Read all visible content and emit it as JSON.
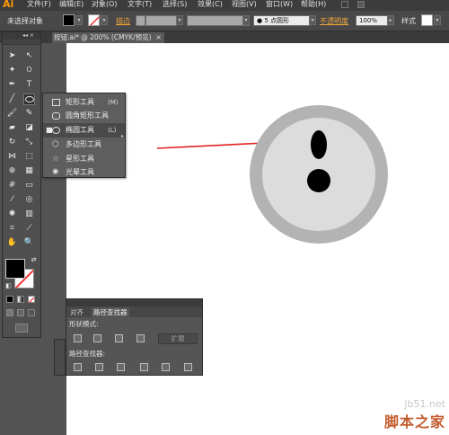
{
  "app": {
    "logo": "Ai"
  },
  "menubar": {
    "items": [
      "文件(F)",
      "编辑(E)",
      "对象(O)",
      "文字(T)",
      "选择(S)",
      "效果(C)",
      "视图(V)",
      "窗口(W)",
      "帮助(H)"
    ]
  },
  "controlbar": {
    "selection_label": "未选择对象",
    "fill_color": "#000000",
    "stroke_label": "描边",
    "brush_label": "5 点圆形",
    "opacity_label": "不透明度",
    "opacity_value": "100%",
    "style_label": "样式"
  },
  "document": {
    "tab_title": "按钮.ai* @ 200% (CMYK/预览)",
    "close_glyph": "×"
  },
  "toolbox": {
    "header": "◂◂ ×"
  },
  "flyout": {
    "items": [
      {
        "label": "矩形工具",
        "shortcut": "(M)",
        "icon": "rectangle-icon",
        "selected": false
      },
      {
        "label": "圆角矩形工具",
        "shortcut": "",
        "icon": "rounded-rectangle-icon",
        "selected": false
      },
      {
        "label": "椭圆工具",
        "shortcut": "(L)",
        "icon": "ellipse-icon",
        "selected": true
      },
      {
        "label": "多边形工具",
        "shortcut": "",
        "icon": "polygon-icon",
        "selected": false
      },
      {
        "label": "星形工具",
        "shortcut": "",
        "icon": "star-icon",
        "selected": false
      },
      {
        "label": "光晕工具",
        "shortcut": "",
        "icon": "flare-icon",
        "selected": false
      }
    ]
  },
  "pathfinder": {
    "tabs": [
      "对齐",
      "路径查找器"
    ],
    "shape_modes_label": "形状模式:",
    "expand_label": "扩展",
    "pathfinders_label": "路径查找器:"
  },
  "watermark": {
    "url": "jb51.net",
    "name": "脚本之家"
  },
  "colors": {
    "arrow": "#e0201f",
    "outer_ring": "#b3b3b3",
    "inner_disc": "#dcdcdc",
    "dots": "#000000"
  }
}
